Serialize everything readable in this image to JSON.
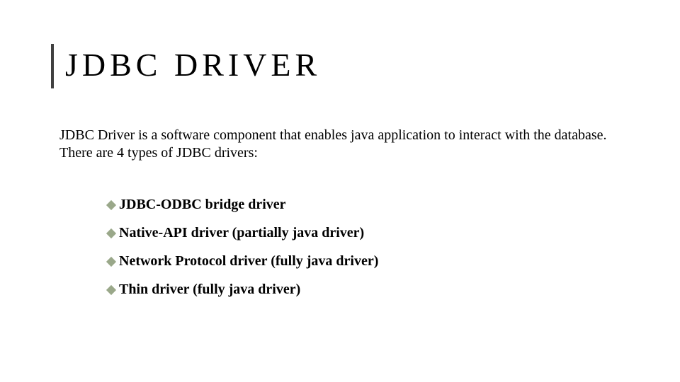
{
  "title": "JDBC DRIVER",
  "intro": "JDBC Driver is a software component that enables java application to interact with the database. There are 4 types of JDBC drivers:",
  "bullets": {
    "b0": "JDBC-ODBC bridge driver",
    "b1": "Native-API driver (partially java driver)",
    "b2": "Network Protocol driver (fully java driver)",
    "b3": "Thin driver (fully java driver)"
  }
}
